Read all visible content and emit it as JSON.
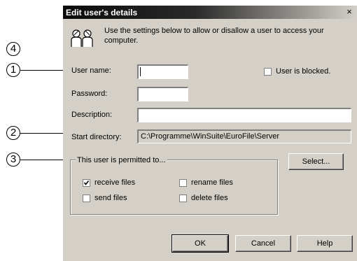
{
  "callouts": [
    "4",
    "1",
    "2",
    "3"
  ],
  "dialog": {
    "title": "Edit user's details",
    "close_label": "×",
    "intro_text": "Use the settings below to allow or disallow a user to access your computer."
  },
  "form": {
    "user_name_label": "User name:",
    "user_name_value": "",
    "password_label": "Password:",
    "password_value": "",
    "description_label": "Description:",
    "description_value": "",
    "start_directory_label": "Start directory:",
    "start_directory_value": "C:\\Programme\\WinSuite\\EuroFile\\Server",
    "blocked_label": "User is blocked.",
    "blocked_checked": false
  },
  "permissions": {
    "group_label": "This user is permitted to...",
    "select_button": "Select...",
    "items": [
      {
        "label": "receive files",
        "checked": true
      },
      {
        "label": "rename files",
        "checked": false
      },
      {
        "label": "send files",
        "checked": false
      },
      {
        "label": "delete files",
        "checked": false
      }
    ]
  },
  "buttons": {
    "ok": "OK",
    "cancel": "Cancel",
    "help": "Help"
  },
  "colors": {
    "dialog_bg": "#d4d0c8",
    "title_bar": "#0a0a0a",
    "title_text": "#ffffff"
  }
}
